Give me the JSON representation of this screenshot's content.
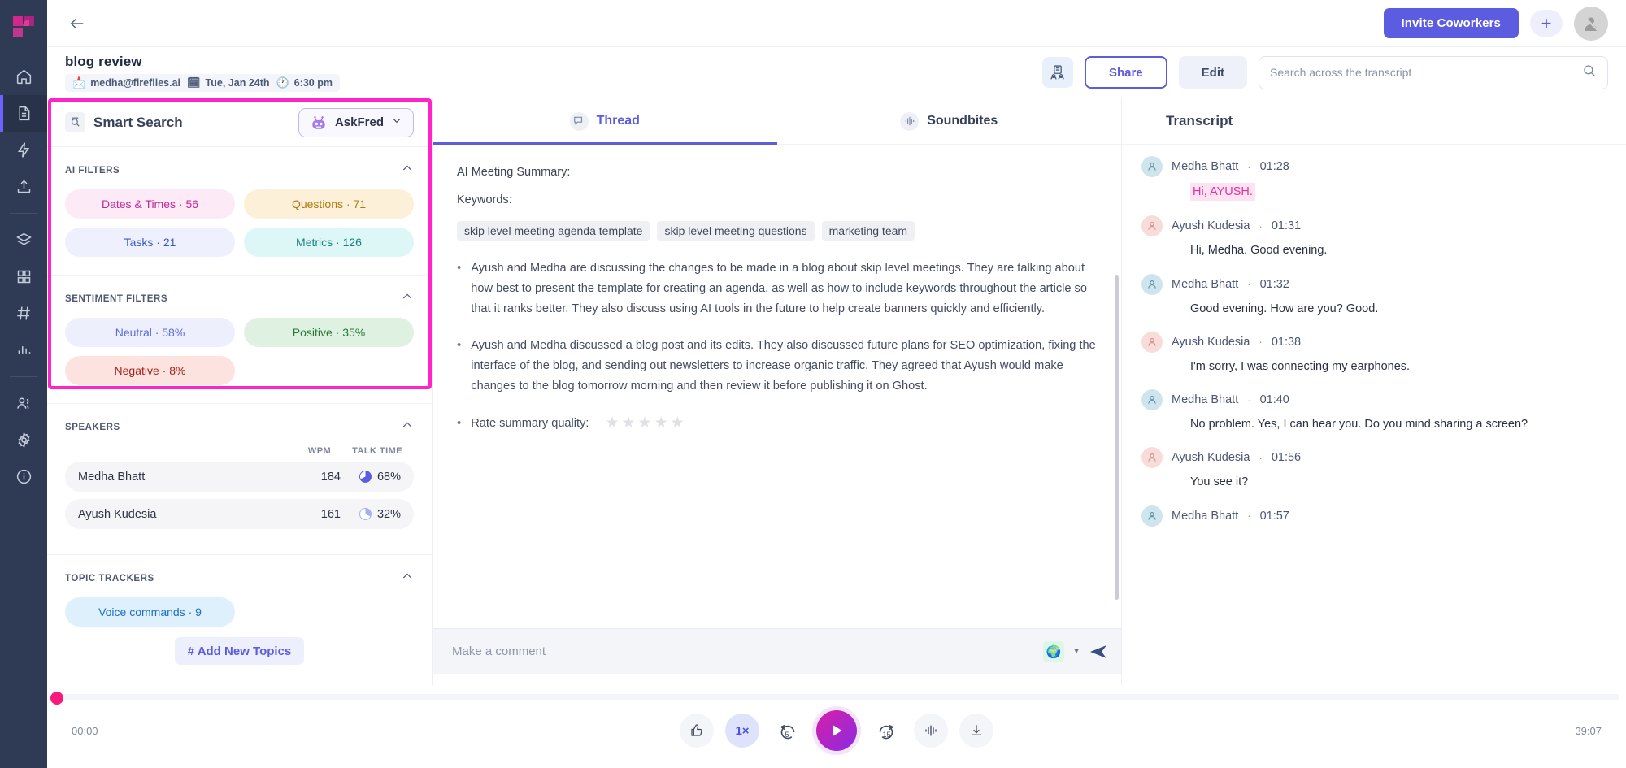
{
  "rail": {
    "logo": "fireflies-logo",
    "items": [
      {
        "name": "home",
        "icon": "home-icon"
      },
      {
        "name": "notes",
        "icon": "document-icon",
        "active": true
      },
      {
        "name": "automation",
        "icon": "lightning-icon"
      },
      {
        "name": "upload",
        "icon": "upload-icon"
      },
      {
        "name": "library",
        "icon": "layers-icon"
      },
      {
        "name": "apps",
        "icon": "grid-icon"
      },
      {
        "name": "channels",
        "icon": "hash-icon"
      },
      {
        "name": "analytics",
        "icon": "bar-chart-icon"
      },
      {
        "name": "team",
        "icon": "users-icon"
      },
      {
        "name": "settings",
        "icon": "gear-icon"
      },
      {
        "name": "help",
        "icon": "info-icon"
      }
    ]
  },
  "topbar": {
    "back": "back-arrow",
    "invite_label": "Invite Coworkers",
    "plus_label": "+"
  },
  "meeting": {
    "title": "blog review",
    "owner": "medha@fireflies.ai",
    "date": "Tue, Jan 24th",
    "time": "6:30 pm",
    "share_label": "Share",
    "edit_label": "Edit"
  },
  "search": {
    "placeholder": "Search across the transcript",
    "value": ""
  },
  "smart_search": {
    "title": "Smart Search",
    "askfred_label": "AskFred",
    "ai_filters": {
      "title": "AI FILTERS",
      "pills": [
        {
          "label": "Dates & Times · 56",
          "bg": "#fdeaf7",
          "fg": "#c02a97"
        },
        {
          "label": "Questions · 71",
          "bg": "#fdf0d9",
          "fg": "#b07a10"
        },
        {
          "label": "Tasks · 21",
          "bg": "#eef0fd",
          "fg": "#3d5bc4"
        },
        {
          "label": "Metrics · 126",
          "bg": "#ddf7f6",
          "fg": "#18827f"
        }
      ]
    },
    "sentiment_filters": {
      "title": "SENTIMENT FILTERS",
      "pills": [
        {
          "label": "Neutral · 58%",
          "bg": "#eeeffd",
          "fg": "#5b6ae0"
        },
        {
          "label": "Positive · 35%",
          "bg": "#dff2e2",
          "fg": "#247a35"
        },
        {
          "label": "Negative · 8%",
          "bg": "#fde3e0",
          "fg": "#a32318"
        }
      ]
    },
    "speakers": {
      "title": "SPEAKERS",
      "col_wpm": "WPM",
      "col_talk": "TALK TIME",
      "rows": [
        {
          "name": "Medha Bhatt",
          "wpm": "184",
          "talk": "68%",
          "color": "#5c5ce0"
        },
        {
          "name": "Ayush Kudesia",
          "wpm": "161",
          "talk": "32%",
          "color": "#a9aef2"
        }
      ]
    },
    "topic_trackers": {
      "title": "TOPIC TRACKERS",
      "pills": [
        {
          "label": "Voice commands · 9",
          "bg": "#def0fc",
          "fg": "#1e6fc4"
        }
      ],
      "add_label": "# Add New Topics"
    }
  },
  "center": {
    "tabs": [
      {
        "label": "Thread",
        "icon": "thread-icon",
        "active": true
      },
      {
        "label": "Soundbites",
        "icon": "waveform-icon",
        "active": false
      }
    ],
    "summary_heading": "AI Meeting Summary:",
    "keywords_label": "Keywords:",
    "keywords": [
      "skip level meeting agenda template",
      "skip level meeting questions",
      "marketing team"
    ],
    "bullets": [
      "Ayush and Medha are discussing the changes to be made in a blog about skip level meetings. They are talking about how best to present the template for creating an agenda, as well as how to include keywords throughout the article so that it ranks better. They also discuss using AI tools in the future to help create banners quickly and efficiently.",
      " Ayush and Medha discussed a blog post and its edits. They also discussed future plans for SEO optimization, fixing the interface of the blog, and sending out newsletters to increase organic traffic. They agreed that Ayush would make changes to the blog tomorrow morning and then review it before publishing it on Ghost."
    ],
    "rate_label": "Rate summary quality:",
    "rate_stars": 5,
    "rate_value": 0,
    "comment_placeholder": "Make a comment",
    "comment_value": ""
  },
  "transcript": {
    "title": "Transcript",
    "items": [
      {
        "speaker": "Medha Bhatt",
        "time": "01:28",
        "text": "Hi, AYUSH.",
        "highlight": true,
        "avatar_bg": "#cfe5ee",
        "avatar_fg": "#5d8ea3"
      },
      {
        "speaker": "Ayush Kudesia",
        "time": "01:31",
        "text": "Hi, Medha. Good evening.",
        "highlight": false,
        "avatar_bg": "#f7dcd9",
        "avatar_fg": "#cf8f86"
      },
      {
        "speaker": "Medha Bhatt",
        "time": "01:32",
        "text": "Good evening. How are you? Good.",
        "highlight": false,
        "avatar_bg": "#cfe5ee",
        "avatar_fg": "#5d8ea3"
      },
      {
        "speaker": "Ayush Kudesia",
        "time": "01:38",
        "text": "I'm sorry, I was connecting my earphones.",
        "highlight": false,
        "avatar_bg": "#f7dcd9",
        "avatar_fg": "#cf8f86"
      },
      {
        "speaker": "Medha Bhatt",
        "time": "01:40",
        "text": "No problem. Yes, I can hear you. Do you mind sharing a screen?",
        "highlight": false,
        "avatar_bg": "#cfe5ee",
        "avatar_fg": "#5d8ea3"
      },
      {
        "speaker": "Ayush Kudesia",
        "time": "01:56",
        "text": "You see it?",
        "highlight": false,
        "avatar_bg": "#f7dcd9",
        "avatar_fg": "#cf8f86"
      },
      {
        "speaker": "Medha Bhatt",
        "time": "01:57",
        "text": "",
        "highlight": false,
        "avatar_bg": "#cfe5ee",
        "avatar_fg": "#5d8ea3"
      }
    ]
  },
  "player": {
    "current_time": "00:00",
    "total_time": "39:07",
    "progress_percent": 0,
    "speed": "1×",
    "rewind": "5",
    "forward": "15",
    "buttons": [
      "thumbs-up-icon",
      "speed-button",
      "rewind-5-icon",
      "play-icon",
      "forward-15-icon",
      "waveform-icon",
      "download-icon"
    ]
  },
  "colors": {
    "accent": "#5c5ce0",
    "highlight_border": "#ff23c8",
    "rail_bg": "#2f3b55",
    "play_knob": "#f8197f"
  }
}
